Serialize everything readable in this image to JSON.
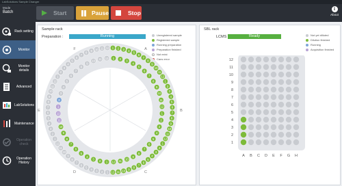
{
  "window": {
    "title": "LabSolutions Sample Changer"
  },
  "mode": {
    "label": "Mode",
    "value": "Batch"
  },
  "toolbar": {
    "start_label": "Start",
    "pause_label": "Pause",
    "stop_label": "Stop",
    "about_label": "About",
    "about_icon": "info-icon"
  },
  "sidebar": {
    "items": [
      {
        "label": "Rack setting",
        "icon": "rack-icon",
        "active": false,
        "enabled": true
      },
      {
        "label": "Monitor",
        "icon": "monitor-icon",
        "active": true,
        "enabled": true
      },
      {
        "label": "Monitor details",
        "icon": "monitor-details-icon",
        "active": false,
        "enabled": true
      },
      {
        "label": "Advanced",
        "icon": "advanced-icon",
        "active": false,
        "enabled": true
      },
      {
        "label": "LabSolutions",
        "icon": "labsolutions-icon",
        "active": false,
        "enabled": true
      },
      {
        "label": "Maintenance",
        "icon": "maintenance-icon",
        "active": false,
        "enabled": true
      },
      {
        "label": "Operation check",
        "icon": "operation-check-icon",
        "active": false,
        "enabled": false
      },
      {
        "label": "Operation History",
        "icon": "history-icon",
        "active": false,
        "enabled": true
      }
    ]
  },
  "sample_rack": {
    "title": "Sample rack",
    "prep_label": "Preparation :",
    "status": "Running",
    "legend": [
      {
        "label": "Unregistered sample",
        "color": "#c8cbd0"
      },
      {
        "label": "Registered sample",
        "color": "#7dbb3a"
      },
      {
        "label": "Running preparation",
        "color": "#7ea6d8"
      },
      {
        "label": "Preparation finished",
        "color": "#b7a3d4"
      },
      {
        "label": "Not exist",
        "color": "#ffffff"
      },
      {
        "label": "Cans error",
        "color": "#ffffff"
      }
    ],
    "sector_labels": [
      "A",
      "B",
      "C",
      "D",
      "E",
      "F"
    ],
    "colors": {
      "registered": "#7dbb3a",
      "prep_finished": "#b7a3d4",
      "running": "#7ea6d8",
      "unregistered": "#c8cbd0"
    },
    "outer_ring": [
      "1",
      "2",
      "3",
      "4",
      "5",
      "6",
      "7",
      "8",
      "9",
      "10",
      "11",
      "12",
      "1",
      "2",
      "3",
      "4",
      "5",
      "6",
      "7",
      "8",
      "9",
      "10",
      "11",
      "12",
      "1",
      "2",
      "3",
      "4",
      "5",
      "6",
      "7",
      "8",
      "9",
      "10",
      "11",
      "12",
      "1",
      "2",
      "3",
      "4",
      "5",
      "6",
      "7",
      "8",
      "9",
      "10",
      "11",
      "12",
      "1",
      "2",
      "3",
      "4",
      "5",
      "6",
      "7",
      "8",
      "9",
      "10",
      "11",
      "12",
      "1",
      "2",
      "3",
      "4",
      "5",
      "6",
      "7",
      "8",
      "9",
      "10",
      "11",
      "12"
    ],
    "inner_ring": [
      "1",
      "2",
      "3",
      "4",
      "5",
      "6",
      "7",
      "8",
      "9",
      "10",
      "11",
      "12",
      "1",
      "2",
      "3",
      "4",
      "5",
      "6",
      "7",
      "8",
      "9",
      "10",
      "11",
      "12",
      "1",
      "2",
      "3",
      "4",
      "5",
      "6",
      "7",
      "8",
      "9",
      "10",
      "11",
      "12",
      "1",
      "2",
      "3",
      "4",
      "5",
      "6",
      "7",
      "8",
      "9",
      "10",
      "11",
      "12"
    ],
    "outer_status": [
      "g",
      "g",
      "g",
      "g",
      "g",
      "g",
      "g",
      "g",
      "g",
      "g",
      "g",
      "g",
      "g",
      "g",
      "g",
      "g",
      "g",
      "g",
      "g",
      "g",
      "g",
      "g",
      "g",
      "g",
      "g",
      "g",
      "g",
      "g",
      "g",
      "g",
      "g",
      "g",
      "g",
      "g",
      "g",
      "g",
      "u",
      "u",
      "u",
      "u",
      "u",
      "u",
      "u",
      "u",
      "u",
      "u",
      "u",
      "u",
      "u",
      "u",
      "u",
      "u",
      "u",
      "u",
      "u",
      "u",
      "u",
      "u",
      "u",
      "u",
      "u",
      "u",
      "u",
      "u",
      "u",
      "u",
      "u",
      "u",
      "u",
      "u",
      "u",
      "u"
    ],
    "inner_status": [
      "g",
      "g",
      "g",
      "g",
      "g",
      "g",
      "g",
      "g",
      "g",
      "g",
      "g",
      "g",
      "g",
      "g",
      "g",
      "g",
      "g",
      "g",
      "g",
      "g",
      "g",
      "g",
      "g",
      "g",
      "g",
      "g",
      "g",
      "g",
      "g",
      "g",
      "g",
      "g",
      "g",
      "g",
      "p",
      "p",
      "p",
      "r",
      "u",
      "u",
      "u",
      "u",
      "u",
      "u",
      "u",
      "u",
      "u",
      "u"
    ]
  },
  "sbl_rack": {
    "title": "SBL rack",
    "lcms_label": "LCMS :",
    "status": "Ready",
    "legend": [
      {
        "label": "Not yet dilluted",
        "color": "#c8cbd0"
      },
      {
        "label": "Dilution finished",
        "color": "#7dbb3a"
      },
      {
        "label": "Running",
        "color": "#7ea6d8"
      },
      {
        "label": "Acquisition finished",
        "color": "#b7a3d4"
      }
    ],
    "rows": [
      "12",
      "11",
      "10",
      "9",
      "8",
      "7",
      "6",
      "5",
      "4",
      "3",
      "2",
      "1"
    ],
    "cols": [
      "A",
      "B",
      "C",
      "D",
      "E",
      "F",
      "G",
      "H"
    ],
    "filled": [
      "A1",
      "A2",
      "A3",
      "A4"
    ]
  }
}
